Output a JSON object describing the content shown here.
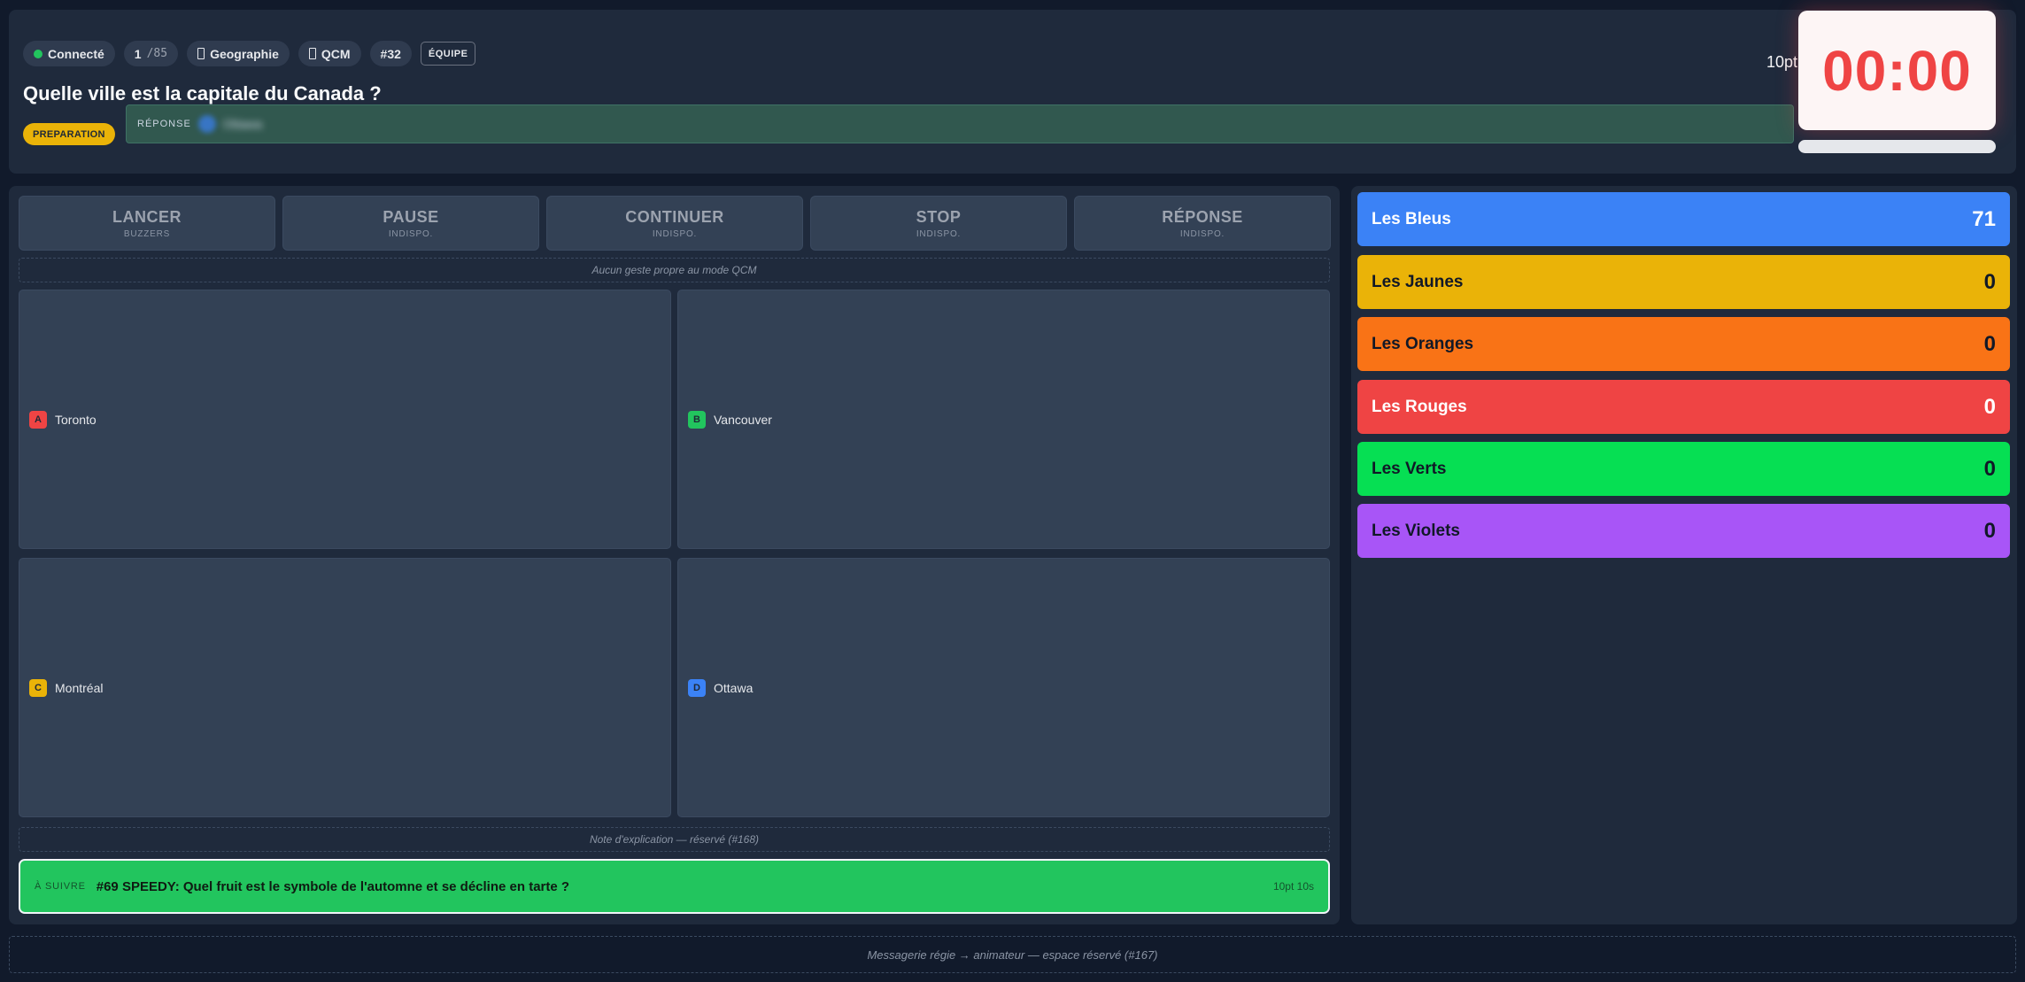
{
  "header": {
    "status": "Connecté",
    "progress_current": "1",
    "progress_total": "/85",
    "category": "Geographie",
    "mode": "QCM",
    "question_id": "#32",
    "team_badge": "ÉQUIPE",
    "question": "Quelle ville est la capitale du Canada ?",
    "phase": "PREPARATION",
    "answer_label": "RÉPONSE",
    "answer_value": "Ottawa",
    "points": "10pt",
    "timer": "00:00",
    "timer_progress": 0
  },
  "controls": [
    {
      "title": "LANCER",
      "sub": "BUZZERS"
    },
    {
      "title": "PAUSE",
      "sub": "INDISPO."
    },
    {
      "title": "CONTINUER",
      "sub": "INDISPO."
    },
    {
      "title": "STOP",
      "sub": "INDISPO."
    },
    {
      "title": "RÉPONSE",
      "sub": "INDISPO."
    }
  ],
  "mode_note": "Aucun geste propre au mode QCM",
  "options": [
    {
      "letter": "A",
      "text": "Toronto",
      "color": "#ef4444"
    },
    {
      "letter": "B",
      "text": "Vancouver",
      "color": "#22c55e"
    },
    {
      "letter": "C",
      "text": "Montréal",
      "color": "#eab308"
    },
    {
      "letter": "D",
      "text": "Ottawa",
      "color": "#3b82f6"
    }
  ],
  "explanation_note": "Note d'explication — réservé (#168)",
  "next": {
    "label": "À SUIVRE",
    "question": "#69 SPEEDY: Quel fruit est le symbole de l'automne et se décline en tarte ?",
    "meta": "10pt 10s"
  },
  "teams": [
    {
      "name": "Les Bleus",
      "score": "71",
      "color": "#3b82f6",
      "text": "#ffffff"
    },
    {
      "name": "Les Jaunes",
      "score": "0",
      "color": "#eab308",
      "text": "#111827"
    },
    {
      "name": "Les Oranges",
      "score": "0",
      "color": "#f97316",
      "text": "#111827"
    },
    {
      "name": "Les Rouges",
      "score": "0",
      "color": "#ef4444",
      "text": "#ffffff"
    },
    {
      "name": "Les Verts",
      "score": "0",
      "color": "#06df53",
      "text": "#111827"
    },
    {
      "name": "Les Violets",
      "score": "0",
      "color": "#a855f7",
      "text": "#111827"
    }
  ],
  "footer": "Messagerie régie → animateur — espace réservé (#167)"
}
